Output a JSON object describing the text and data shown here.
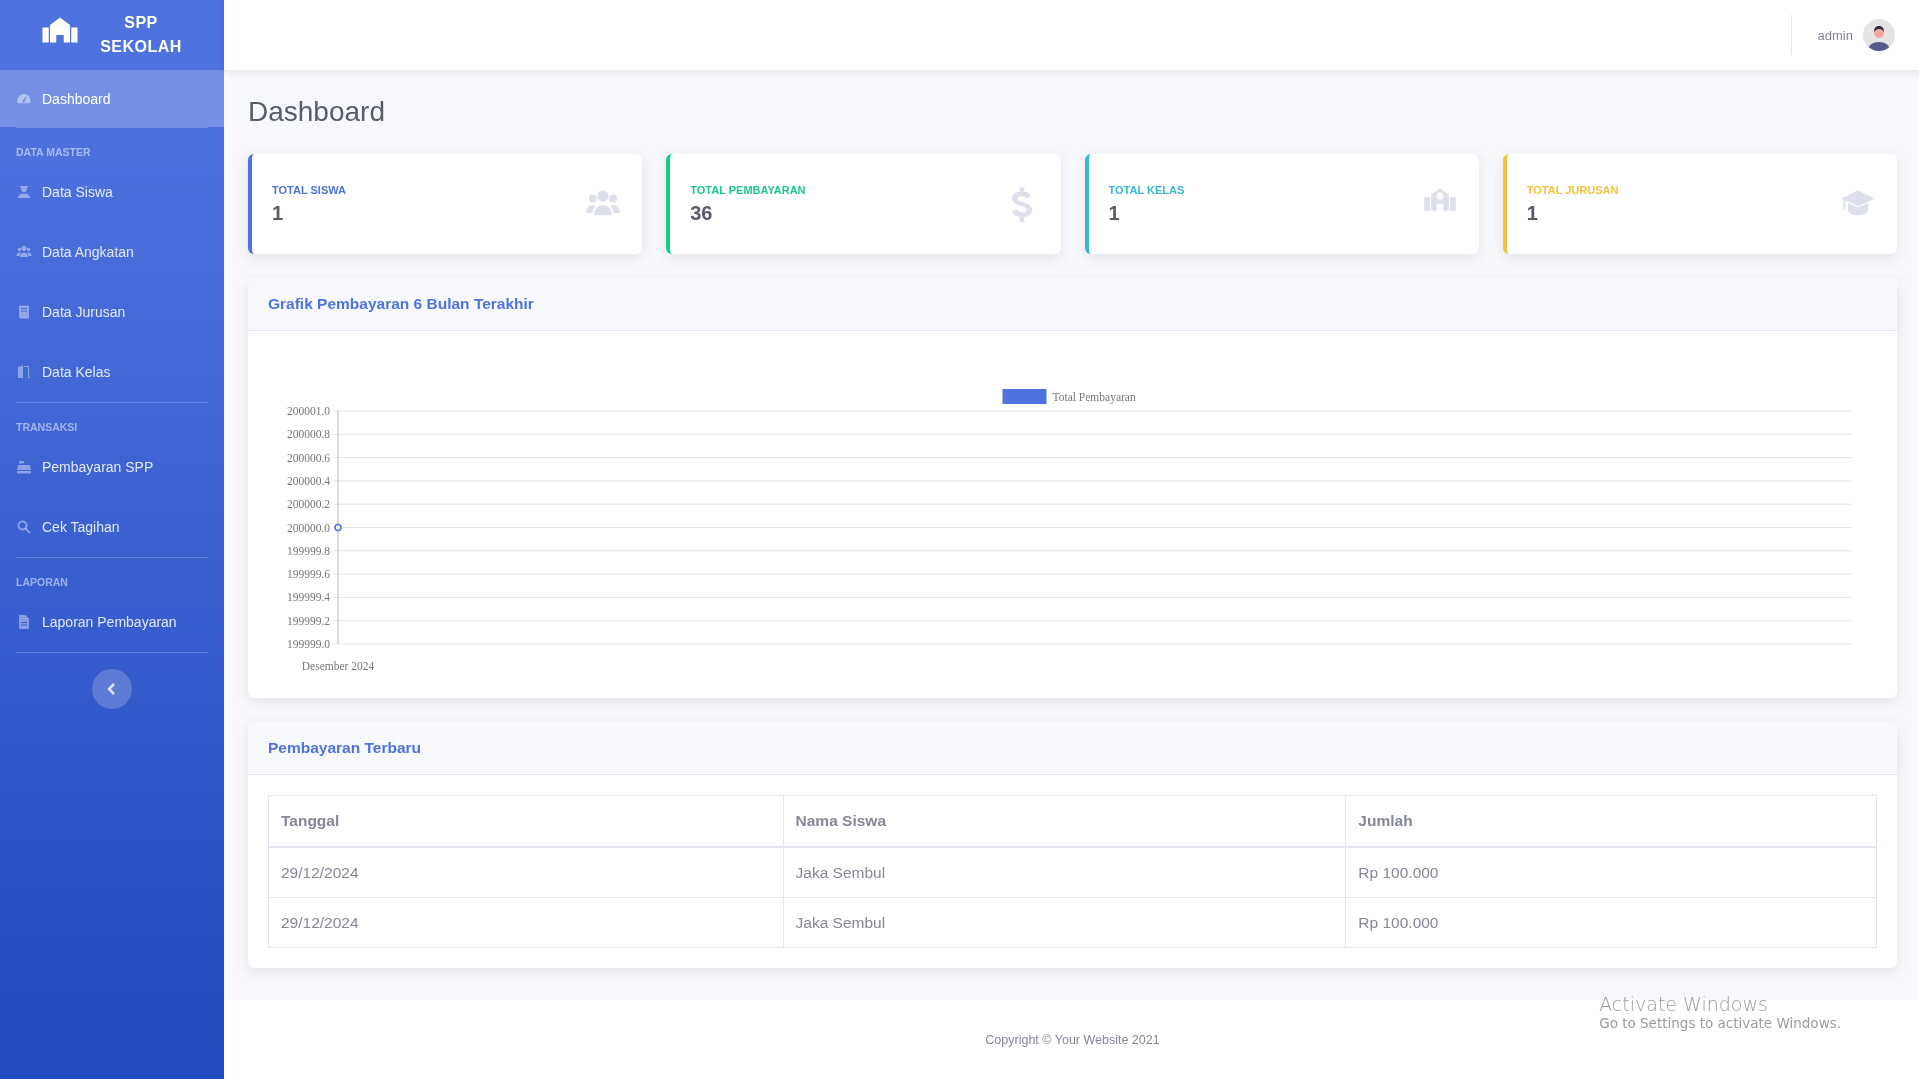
{
  "sidebar": {
    "brand": "SPP SEKOLAH",
    "sections": [
      {
        "items": [
          {
            "label": "Dashboard",
            "selected": true
          }
        ]
      },
      {
        "heading": "DATA MASTER",
        "items": [
          {
            "label": "Data Siswa",
            "selected": false
          },
          {
            "label": "Data Angkatan",
            "selected": false
          },
          {
            "label": "Data Jurusan",
            "selected": false
          },
          {
            "label": "Data Kelas",
            "selected": false
          }
        ]
      },
      {
        "heading": "TRANSAKSI",
        "items": [
          {
            "label": "Pembayaran SPP",
            "selected": false
          },
          {
            "label": "Cek Tagihan",
            "selected": false
          }
        ]
      },
      {
        "heading": "LAPORAN",
        "items": [
          {
            "label": "Laporan Pembayaran",
            "selected": false
          }
        ]
      }
    ]
  },
  "topbar": {
    "user": "admin"
  },
  "page_title": "Dashboard",
  "stat_cards": [
    {
      "label": "TOTAL SISWA",
      "value": "1",
      "color": "#4e73df"
    },
    {
      "label": "TOTAL PEMBAYARAN",
      "value": "36",
      "color": "#1cc88a"
    },
    {
      "label": "TOTAL KELAS",
      "value": "1",
      "color": "#36b9cc"
    },
    {
      "label": "TOTAL JURUSAN",
      "value": "1",
      "color": "#f6c23e"
    }
  ],
  "chart_card": {
    "title": "Grafik Pembayaran 6 Bulan Terakhir",
    "chart_data": {
      "type": "line",
      "categories": [
        "Desember 2024"
      ],
      "series": [
        {
          "name": "Total Pembayaran",
          "color": "#4e73df",
          "marker": "circle",
          "values": [
            200000
          ]
        }
      ],
      "ylim": [
        199999,
        200001
      ],
      "grid": true,
      "yticks": [
        {
          "value": 199999,
          "label": "199999.0"
        },
        {
          "value": 199999.2,
          "label": "199999.2"
        },
        {
          "value": 199999.4,
          "label": "199999.4"
        },
        {
          "value": 199999.6,
          "label": "199999.6"
        },
        {
          "value": 199999.8,
          "label": "199999.8"
        },
        {
          "value": 200000,
          "label": "200000.0"
        },
        {
          "value": 200000.2,
          "label": "200000.2"
        },
        {
          "value": 200000.4,
          "label": "200000.4"
        },
        {
          "value": 200000.6,
          "label": "200000.6"
        },
        {
          "value": 200000.8,
          "label": "200000.8"
        },
        {
          "value": 200001,
          "label": "200001.0"
        }
      ]
    }
  },
  "table_card": {
    "title": "Pembayaran Terbaru",
    "columns": [
      "Tanggal",
      "Nama Siswa",
      "Jumlah"
    ],
    "rows": [
      [
        "29/12/2024",
        "Jaka Sembul",
        "Rp 100.000"
      ],
      [
        "29/12/2024",
        "Jaka Sembul",
        "Rp 100.000"
      ]
    ]
  },
  "footer": "Copyright © Your Website 2021",
  "os_notice": {
    "title": "Activate Windows",
    "subtitle": "Go to Settings to activate Windows."
  }
}
